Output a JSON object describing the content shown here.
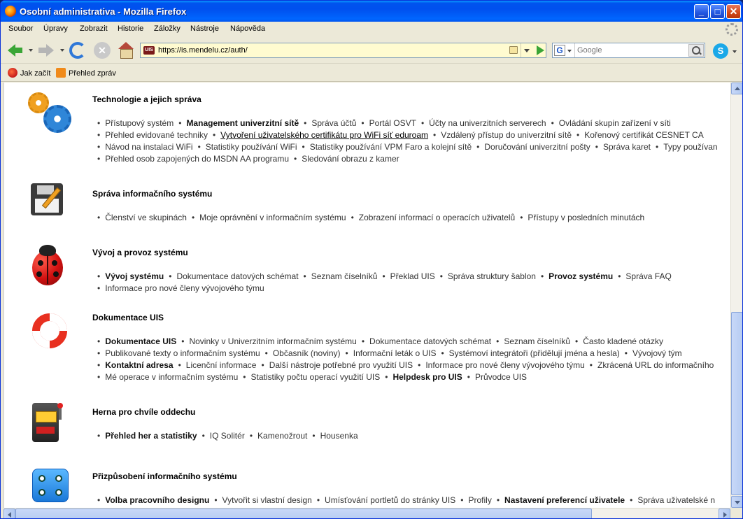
{
  "window": {
    "title": "Osobní administrativa - Mozilla Firefox"
  },
  "menu": [
    "Soubor",
    "Úpravy",
    "Zobrazit",
    "Historie",
    "Záložky",
    "Nástroje",
    "Nápověda"
  ],
  "nav": {
    "site_badge": "UIS",
    "url": "https://is.mendelu.cz/auth/",
    "search_placeholder": "Google",
    "search_engine_letter": "G",
    "skype_letter": "S"
  },
  "bookmarks": [
    "Jak začít",
    "Přehled zpráv"
  ],
  "sections": [
    {
      "title": "Technologie a jejich správa",
      "rows": [
        [
          {
            "t": "Přístupový systém"
          },
          {
            "t": "Management univerzitní sítě",
            "b": true
          },
          {
            "t": "Správa účtů"
          },
          {
            "t": "Portál OSVT"
          },
          {
            "t": "Účty na univerzitních serverech"
          },
          {
            "t": "Ovládání skupin zařízení v síti"
          }
        ],
        [
          {
            "t": "Přehled evidované techniky"
          },
          {
            "t": "Vytvoření uživatelského certifikátu pro WiFi síť eduroam",
            "u": true
          },
          {
            "t": "Vzdálený přístup do univerzitní sítě"
          },
          {
            "t": "Kořenový certifikát CESNET CA"
          }
        ],
        [
          {
            "t": "Návod na instalaci WiFi"
          },
          {
            "t": "Statistiky používání WiFi"
          },
          {
            "t": "Statistiky používání VPM Faro a kolejní sítě"
          },
          {
            "t": "Doručování univerzitní pošty"
          },
          {
            "t": "Správa karet"
          },
          {
            "t": "Typy používan"
          }
        ],
        [
          {
            "t": "Přehled osob zapojených do MSDN AA programu"
          },
          {
            "t": "Sledování obrazu z kamer"
          }
        ]
      ]
    },
    {
      "title": "Správa informačního systému",
      "rows": [
        [
          {
            "t": "Členství ve skupinách"
          },
          {
            "t": "Moje oprávnění v informačním systému"
          },
          {
            "t": "Zobrazení informací o operacích uživatelů"
          },
          {
            "t": "Přístupy v posledních minutách"
          }
        ]
      ]
    },
    {
      "title": "Vývoj a provoz systému",
      "rows": [
        [
          {
            "t": "Vývoj systému",
            "b": true
          },
          {
            "t": "Dokumentace datových schémat"
          },
          {
            "t": "Seznam číselníků"
          },
          {
            "t": "Překlad UIS"
          },
          {
            "t": "Správa struktury šablon"
          },
          {
            "t": "Provoz systému",
            "b": true
          },
          {
            "t": "Správa FAQ"
          }
        ],
        [
          {
            "t": "Informace pro nové členy vývojového týmu"
          }
        ]
      ]
    },
    {
      "title": "Dokumentace UIS",
      "rows": [
        [
          {
            "t": "Dokumentace UIS",
            "b": true
          },
          {
            "t": "Novinky v Univerzitním informačním systému"
          },
          {
            "t": "Dokumentace datových schémat"
          },
          {
            "t": "Seznam číselníků"
          },
          {
            "t": "Často kladené otázky"
          }
        ],
        [
          {
            "t": "Publikované texty o informačním systému"
          },
          {
            "t": "Občasník (noviny)"
          },
          {
            "t": "Informační leták o UIS"
          },
          {
            "t": "Systémoví integrátoři (přidělují jména a hesla)"
          },
          {
            "t": "Vývojový tým"
          }
        ],
        [
          {
            "t": "Kontaktní adresa",
            "b": true
          },
          {
            "t": "Licenční informace"
          },
          {
            "t": "Další nástroje potřebné pro využití UIS"
          },
          {
            "t": "Informace pro nové členy vývojového týmu"
          },
          {
            "t": "Zkrácená URL do informačního"
          }
        ],
        [
          {
            "t": "Mé operace v informačním systému"
          },
          {
            "t": "Statistiky počtu operací využití UIS"
          },
          {
            "t": "Helpdesk pro UIS",
            "b": true
          },
          {
            "t": "Průvodce UIS"
          }
        ]
      ]
    },
    {
      "title": "Herna pro chvíle oddechu",
      "rows": [
        [
          {
            "t": "Přehled her a statistiky",
            "b": true
          },
          {
            "t": "IQ Solitér"
          },
          {
            "t": "Kamenožrout"
          },
          {
            "t": "Housenka"
          }
        ]
      ]
    },
    {
      "title": "Přizpůsobení informačního systému",
      "rows": [
        [
          {
            "t": "Volba pracovního designu",
            "b": true
          },
          {
            "t": "Vytvořit si vlastní design"
          },
          {
            "t": "Umísťování portletů do stránky UIS"
          },
          {
            "t": "Profily"
          },
          {
            "t": "Nastavení preferencí uživatele",
            "b": true
          },
          {
            "t": "Správa uživatelské n"
          }
        ]
      ]
    }
  ],
  "colors": {
    "titlebar": "#0053ee",
    "urlbar_bg": "#fffbd0",
    "accent_green": "#3aa536"
  }
}
